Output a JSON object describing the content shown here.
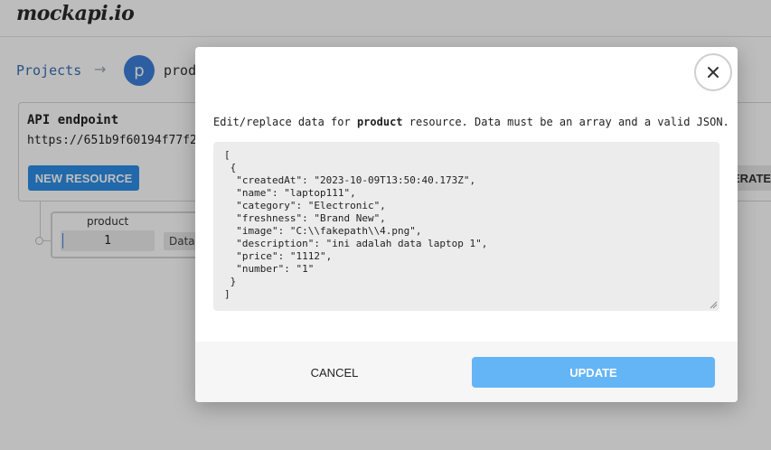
{
  "app": {
    "logo_text": "mockapi.io"
  },
  "breadcrumb": {
    "projects_label": "Projects",
    "separator": "→",
    "avatar_letter": "p",
    "project_name": "prod"
  },
  "api": {
    "title": "API endpoint",
    "url": "https://651b9f60194f77f2"
  },
  "toolbar": {
    "new_resource_label": "NEW RESOURCE",
    "generate_label": "ERATE"
  },
  "resource": {
    "name": "product",
    "count": "1",
    "data_label": "Data"
  },
  "modal": {
    "desc_prefix": "Edit/replace data for ",
    "resource_name": "product",
    "desc_suffix": " resource. Data must be an array and a valid JSON.",
    "json_value": "[\n {\n  \"createdAt\": \"2023-10-09T13:50:40.173Z\",\n  \"name\": \"laptop111\",\n  \"category\": \"Electronic\",\n  \"freshness\": \"Brand New\",\n  \"image\": \"C:\\\\fakepath\\\\4.png\",\n  \"description\": \"ini adalah data laptop 1\",\n  \"price\": \"1112\",\n  \"number\": \"1\"\n }\n]",
    "cancel_label": "CANCEL",
    "update_label": "UPDATE",
    "close_icon": "close-icon"
  },
  "colors": {
    "accent": "#2d8ee6",
    "update_button": "#64b5f6",
    "link": "#3b6fb5"
  }
}
